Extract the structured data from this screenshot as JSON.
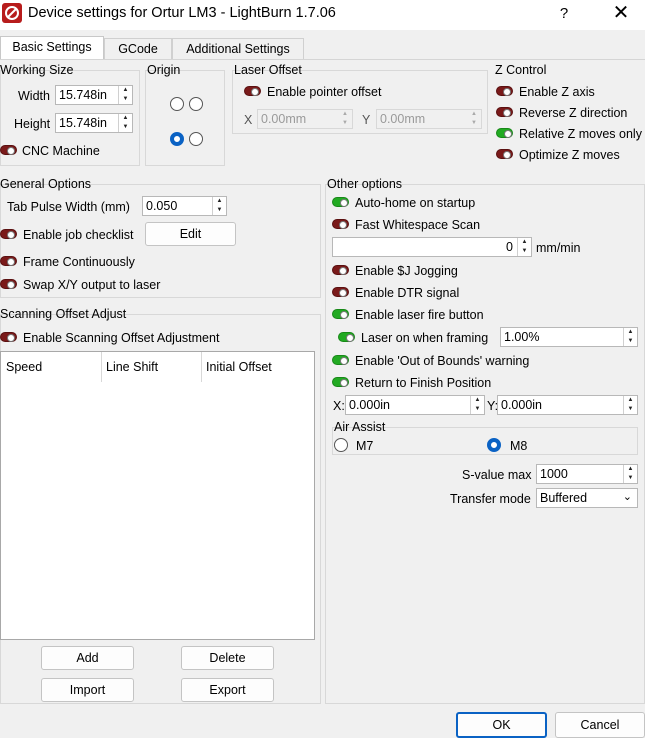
{
  "window": {
    "title": "Device settings for Ortur LM3 - LightBurn 1.7.06",
    "help_glyph": "?",
    "close_glyph": "✕"
  },
  "tabs": [
    {
      "label": "Basic Settings",
      "active": true
    },
    {
      "label": "GCode",
      "active": false
    },
    {
      "label": "Additional Settings",
      "active": false
    }
  ],
  "working_size": {
    "title": "Working Size",
    "width_label": "Width",
    "width_value": "15.748in",
    "height_label": "Height",
    "height_value": "15.748in",
    "cnc_label": "CNC Machine",
    "cnc_enabled": false
  },
  "origin": {
    "title": "Origin",
    "selected": "bottom-left"
  },
  "laser_offset": {
    "title": "Laser Offset",
    "enable_label": "Enable pointer offset",
    "enabled": false,
    "x_label": "X",
    "x_value": "0.00mm",
    "y_label": "Y",
    "y_value": "0.00mm"
  },
  "z_control": {
    "title": "Z Control",
    "items": [
      {
        "label": "Enable Z axis",
        "on": false
      },
      {
        "label": "Reverse Z direction",
        "on": false
      },
      {
        "label": "Relative Z moves only",
        "on": true
      },
      {
        "label": "Optimize Z moves",
        "on": false
      }
    ]
  },
  "general_options": {
    "title": "General Options",
    "tab_pulse_label": "Tab Pulse Width (mm)",
    "tab_pulse_value": "0.050",
    "job_checklist_label": "Enable job checklist",
    "job_checklist_on": false,
    "edit_label": "Edit",
    "frame_label": "Frame Continuously",
    "frame_on": false,
    "swap_label": "Swap X/Y output to laser",
    "swap_on": false
  },
  "scanning_offset": {
    "title": "Scanning Offset Adjust",
    "enable_label": "Enable Scanning Offset Adjustment",
    "enabled": false,
    "columns": [
      "Speed",
      "Line Shift",
      "Initial Offset"
    ],
    "add_label": "Add",
    "delete_label": "Delete",
    "import_label": "Import",
    "export_label": "Export"
  },
  "other_options": {
    "title": "Other options",
    "auto_home_label": "Auto-home on startup",
    "auto_home_on": true,
    "fast_ws_label": "Fast Whitespace Scan",
    "fast_ws_on": false,
    "fast_ws_value": "0",
    "fast_ws_unit": "mm/min",
    "jogging_label": "Enable $J Jogging",
    "jogging_on": false,
    "dtr_label": "Enable DTR signal",
    "dtr_on": false,
    "fire_label": "Enable laser fire button",
    "fire_on": true,
    "framing_label": "Laser on when framing",
    "framing_on": true,
    "framing_value": "1.00%",
    "oob_label": "Enable 'Out of Bounds' warning",
    "oob_on": true,
    "return_label": "Return to Finish Position",
    "return_on": true,
    "x_label": "X:",
    "x_value": "0.000in",
    "y_label": "Y:",
    "y_value": "0.000in",
    "air_assist_title": "Air Assist",
    "m7_label": "M7",
    "m8_label": "M8",
    "air_assist_selected": "M8",
    "svalue_label": "S-value max",
    "svalue_value": "1000",
    "transfer_label": "Transfer mode",
    "transfer_value": "Buffered"
  },
  "footer": {
    "ok_label": "OK",
    "cancel_label": "Cancel"
  },
  "colors": {
    "toggle_off": "#7a1a1a",
    "toggle_on": "#22aa22",
    "radio_accent": "#0a62c4",
    "ok_border": "#0a62c4"
  }
}
